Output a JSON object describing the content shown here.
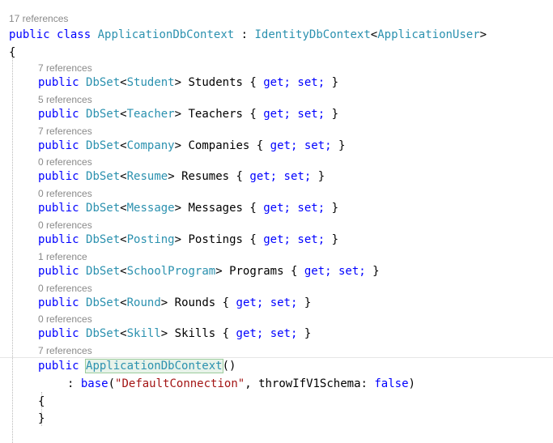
{
  "class_header": {
    "refs": "17 references",
    "kw_public": "public",
    "kw_class": "class",
    "class_name": "ApplicationDbContext",
    "colon": " : ",
    "base_type": "IdentityDbContext",
    "lt": "<",
    "generic_arg": "ApplicationUser",
    "gt": ">",
    "open_brace": "{"
  },
  "members": [
    {
      "refs": "7 references",
      "public": "public",
      "dbset": "DbSet",
      "lt": "<",
      "type": "Student",
      "gt": ">",
      "name": "Students",
      "ob": "{",
      "get": "get;",
      "set": "set;",
      "cb": "}"
    },
    {
      "refs": "5 references",
      "public": "public",
      "dbset": "DbSet",
      "lt": "<",
      "type": "Teacher",
      "gt": ">",
      "name": "Teachers",
      "ob": "{",
      "get": "get;",
      "set": "set;",
      "cb": "}"
    },
    {
      "refs": "7 references",
      "public": "public",
      "dbset": "DbSet",
      "lt": "<",
      "type": "Company",
      "gt": ">",
      "name": "Companies",
      "ob": "{",
      "get": "get;",
      "set": "set;",
      "cb": "}"
    },
    {
      "refs": "0 references",
      "public": "public",
      "dbset": "DbSet",
      "lt": "<",
      "type": "Resume",
      "gt": ">",
      "name": "Resumes",
      "ob": "{",
      "get": "get;",
      "set": "set;",
      "cb": "}"
    },
    {
      "refs": "0 references",
      "public": "public",
      "dbset": "DbSet",
      "lt": "<",
      "type": "Message",
      "gt": ">",
      "name": "Messages",
      "ob": "{",
      "get": "get;",
      "set": "set;",
      "cb": "}"
    },
    {
      "refs": "0 references",
      "public": "public",
      "dbset": "DbSet",
      "lt": "<",
      "type": "Posting",
      "gt": ">",
      "name": "Postings",
      "ob": "{",
      "get": "get;",
      "set": "set;",
      "cb": "}"
    },
    {
      "refs": "1 reference",
      "public": "public",
      "dbset": "DbSet",
      "lt": "<",
      "type": "SchoolProgram",
      "gt": ">",
      "name": "Programs",
      "ob": "{",
      "get": "get;",
      "set": "set;",
      "cb": "}"
    },
    {
      "refs": "0 references",
      "public": "public",
      "dbset": "DbSet",
      "lt": "<",
      "type": "Round",
      "gt": ">",
      "name": "Rounds",
      "ob": "{",
      "get": "get;",
      "set": "set;",
      "cb": "}"
    },
    {
      "refs": "0 references",
      "public": "public",
      "dbset": "DbSet",
      "lt": "<",
      "type": "Skill",
      "gt": ">",
      "name": "Skills",
      "ob": "{",
      "get": "get;",
      "set": "set;",
      "cb": "}"
    }
  ],
  "constructor": {
    "refs": "7 references",
    "kw_public": "public",
    "name": "ApplicationDbContext",
    "parens": "()",
    "colon": ":",
    "base_kw": "base",
    "open_paren": "(",
    "conn_string": "\"DefaultConnection\"",
    "comma": ",",
    "param_name": "throwIfV1Schema:",
    "false_kw": "false",
    "close_paren": ")",
    "open_brace": "{",
    "close_brace": "}"
  }
}
